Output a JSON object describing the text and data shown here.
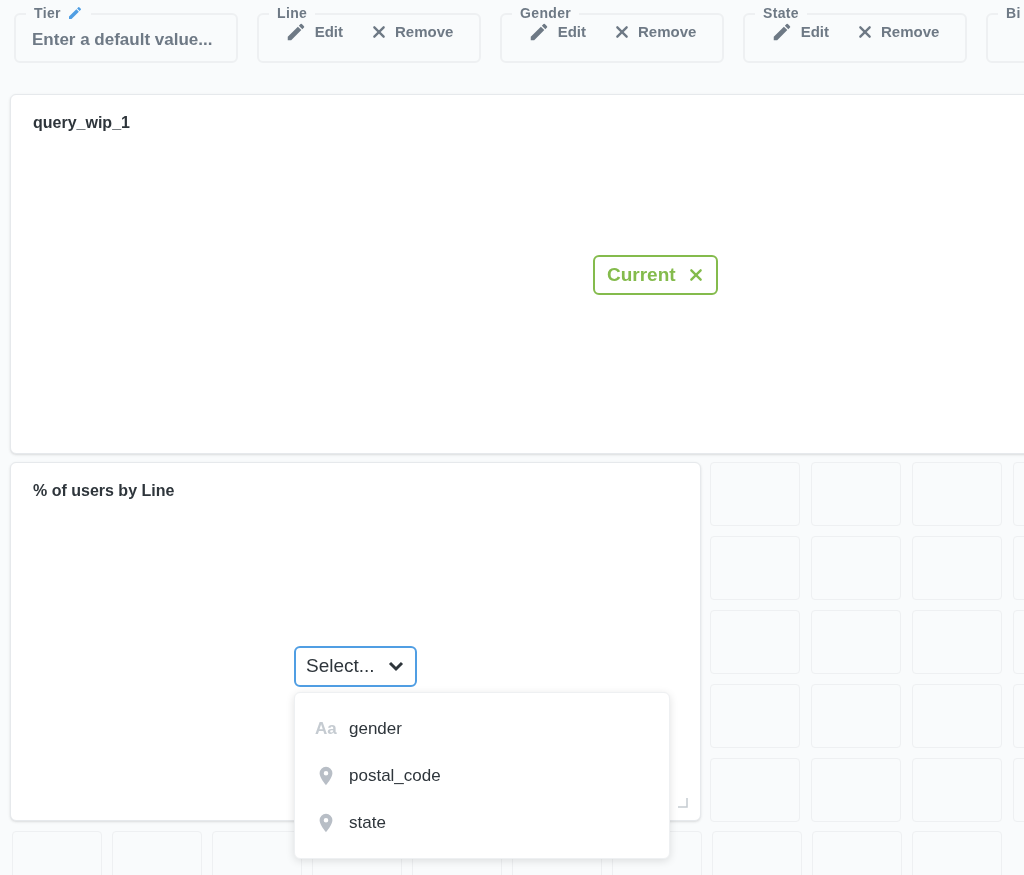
{
  "filters": [
    {
      "label": "Tier",
      "kind": "input",
      "placeholder": "Enter a default value..."
    },
    {
      "label": "Line",
      "kind": "actions",
      "edit": "Edit",
      "remove": "Remove"
    },
    {
      "label": "Gender",
      "kind": "actions",
      "edit": "Edit",
      "remove": "Remove"
    },
    {
      "label": "State",
      "kind": "actions",
      "edit": "Edit",
      "remove": "Remove"
    },
    {
      "label": "Bi",
      "kind": "cut"
    }
  ],
  "cards": [
    {
      "title": "query_wip_1",
      "badge": "Current"
    },
    {
      "title": "% of users by Line",
      "select": "Select...",
      "options": [
        {
          "label": "gender",
          "kind": "text",
          "type_label": "Aa"
        },
        {
          "label": "postal_code",
          "kind": "location"
        },
        {
          "label": "state",
          "kind": "location"
        }
      ]
    }
  ]
}
